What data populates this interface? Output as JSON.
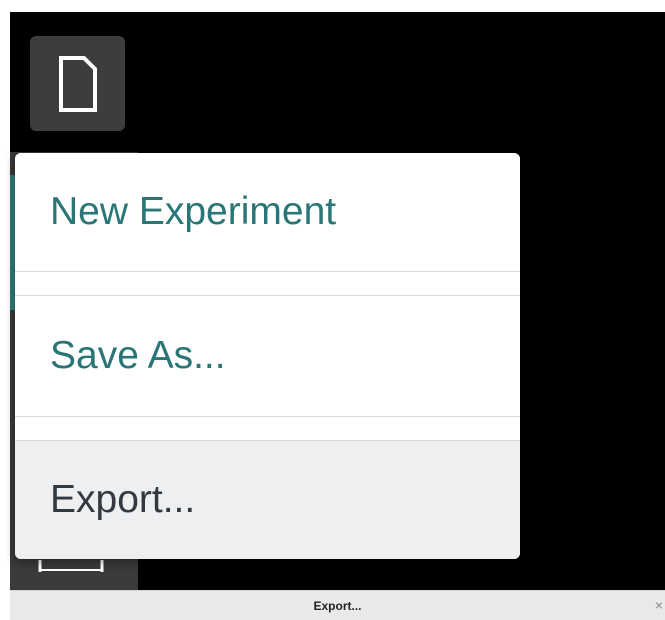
{
  "toolbar": {
    "file_icon": "document-icon"
  },
  "menu": {
    "items": [
      {
        "label": "New Experiment",
        "icon": "none",
        "state": "normal"
      },
      {
        "label": "Save As...",
        "icon": "none",
        "state": "normal"
      },
      {
        "label": "Export...",
        "icon": "none",
        "state": "hovered"
      }
    ]
  },
  "status_bar": {
    "text": "Export...",
    "close_icon": "close-icon",
    "close_glyph": "×"
  },
  "colors": {
    "menu_text": "#2a7575",
    "hover_text": "#333940",
    "hover_bg": "#edeff0",
    "canvas_bg": "#000000",
    "accent": "#2f7f7c"
  }
}
